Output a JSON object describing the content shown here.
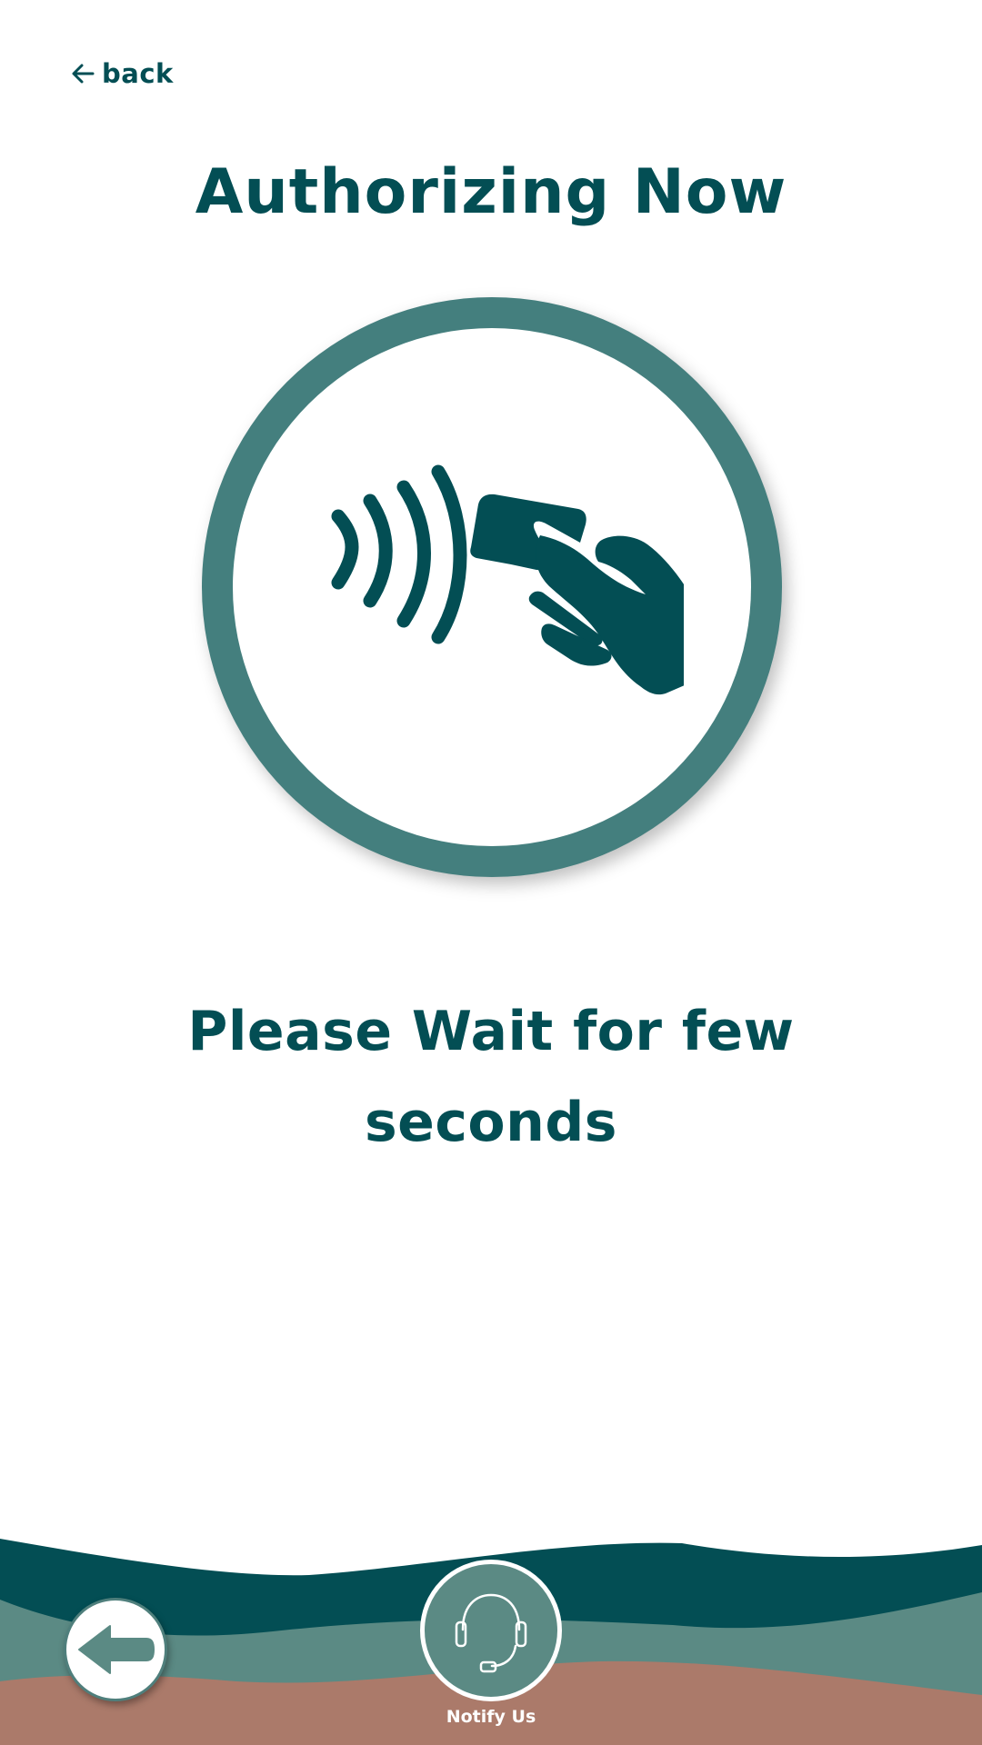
{
  "header": {
    "back_label": "back",
    "title": "Authorizing Now"
  },
  "main": {
    "illustration_icon": "contactless-card-tap-icon",
    "message": "Please Wait for few seconds"
  },
  "footer": {
    "back_icon": "arrow-left-icon",
    "notify_icon": "headset-icon",
    "notify_label": "Notify Us"
  },
  "colors": {
    "primary": "#034e54",
    "ring": "#447f7e",
    "wave_dark": "#034e54",
    "wave_mid": "#5b8a84",
    "wave_clay": "#ab7a6a",
    "background": "#ffffff"
  }
}
